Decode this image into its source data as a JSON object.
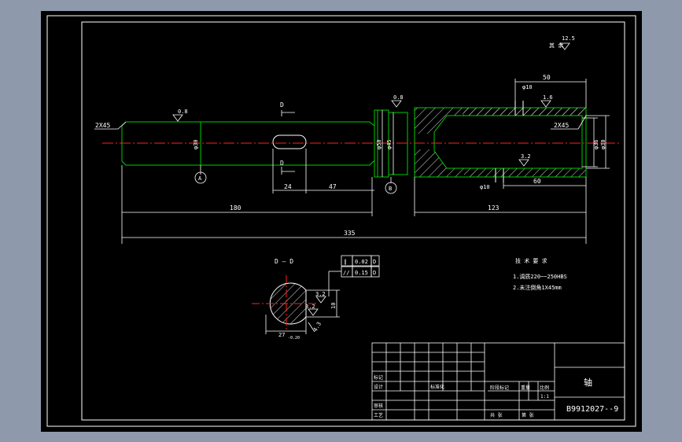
{
  "colors": {
    "background": "#8e9aab",
    "paper": "#000000",
    "line": "#ffffff",
    "part_outline": "#00cc00",
    "center_line": "#ff2020",
    "hatch": "#e0e0e0",
    "dim_text": "#ffffff"
  },
  "main_view": {
    "chamfer_left": "2X45",
    "chamfer_right": "2X45",
    "section_marker_top": "D",
    "section_marker_bottom": "D",
    "datum_a": "A",
    "datum_b": "B",
    "roughness_1": "0.8",
    "roughness_2": "0.8",
    "roughness_3": "1.6",
    "roughness_4": "3.2",
    "dia_journal": "φ30",
    "dia_shoulder_1": "φ50",
    "dia_shoulder_2": "φ45",
    "dia_bore_1": "φ36",
    "dia_bore_2": "φ30",
    "hole_top": "φ10",
    "hole_bottom": "φ10",
    "dim_keyway_len": "24",
    "dim_keyway_pos": "47",
    "dim_180": "180",
    "dim_123": "123",
    "dim_335": "335",
    "dim_50": "50",
    "dim_60": "60"
  },
  "section_view": {
    "title": "D — D",
    "tol_1_symbol": "∥",
    "tol_1_value": "0.02",
    "tol_1_datum": "D",
    "tol_2_symbol": "//",
    "tol_2_value": "0.15",
    "tol_2_datum": "D",
    "roughness_a": "3.2",
    "roughness_b": "3.2",
    "dim_width": "27",
    "dim_width_tol": "-0.20",
    "dim_key": "10",
    "dim_small": "4.3"
  },
  "top_right": {
    "label": "其 余",
    "roughness": "12.5"
  },
  "requirements": {
    "title": "技 术 要 求",
    "line1": "1.调质220~~250HBS",
    "line2": "2.未注倒角1X45mm"
  },
  "title_block": {
    "part_name": "轴",
    "drawing_no": "B9912027--9",
    "scale": "1:1",
    "row_label_1": "标记",
    "row_label_2": "设计",
    "row_label_3": "审核",
    "row_label_4": "工艺",
    "col_label_1": "标准化",
    "col_label_2": "阶段标记",
    "col_label_3": "重量",
    "col_label_4": "比例",
    "sheet_total": "共  张",
    "sheet_no": "第  张"
  }
}
